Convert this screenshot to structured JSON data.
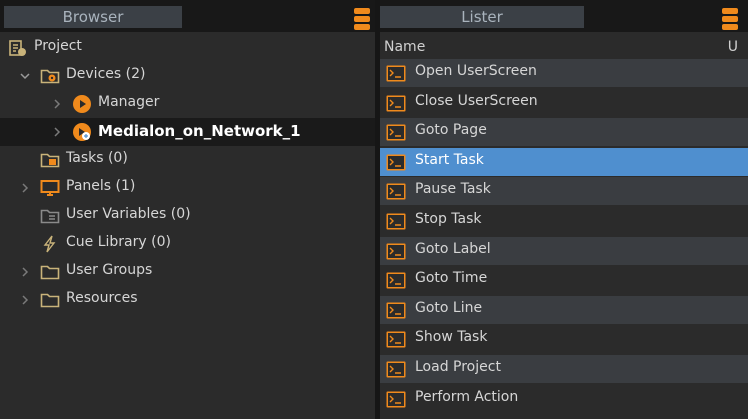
{
  "browser": {
    "title": "Browser",
    "tree": [
      {
        "label": "Project",
        "icon": "project-icon",
        "indent": 0,
        "chevron": "none"
      },
      {
        "label": "Devices (2)",
        "icon": "folder-gear-icon",
        "indent": 1,
        "chevron": "down"
      },
      {
        "label": "Manager",
        "icon": "manager-play-icon",
        "indent": 2,
        "chevron": "right"
      },
      {
        "label": "Medialon_on_Network_1",
        "icon": "network-device-icon",
        "indent": 2,
        "chevron": "right",
        "selected": true
      },
      {
        "label": "Tasks (0)",
        "icon": "folder-tasks-icon",
        "indent": 1,
        "chevron": "none"
      },
      {
        "label": "Panels (1)",
        "icon": "monitor-icon",
        "indent": 1,
        "chevron": "right"
      },
      {
        "label": "User Variables (0)",
        "icon": "folder-variables-icon",
        "indent": 1,
        "chevron": "none"
      },
      {
        "label": "Cue Library (0)",
        "icon": "lightning-icon",
        "indent": 1,
        "chevron": "none"
      },
      {
        "label": "User Groups",
        "icon": "folder-icon",
        "indent": 1,
        "chevron": "right"
      },
      {
        "label": "Resources",
        "icon": "folder-icon",
        "indent": 1,
        "chevron": "right"
      }
    ]
  },
  "lister": {
    "title": "Lister",
    "columns": {
      "name": "Name",
      "second": "U"
    },
    "items": [
      {
        "label": "Open UserScreen"
      },
      {
        "label": "Close UserScreen"
      },
      {
        "label": "Goto Page"
      },
      {
        "label": "Start Task",
        "selected": true
      },
      {
        "label": "Pause Task"
      },
      {
        "label": "Stop Task"
      },
      {
        "label": "Goto Label"
      },
      {
        "label": "Goto Time"
      },
      {
        "label": "Goto Line"
      },
      {
        "label": "Show Task"
      },
      {
        "label": "Load Project"
      },
      {
        "label": "Perform Action"
      }
    ]
  },
  "colors": {
    "accent": "#f08a1c",
    "selection": "#4f8fcf",
    "panel_bg": "#2b2b2b",
    "row_alt": "#3a3d41"
  }
}
